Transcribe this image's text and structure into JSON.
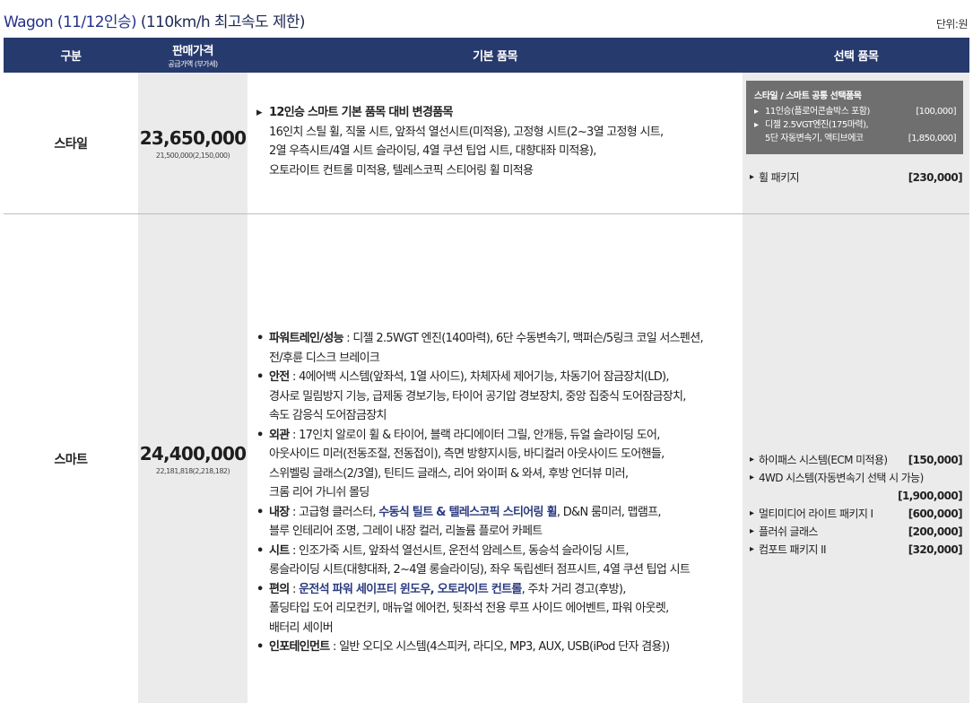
{
  "header": {
    "title_main": "Wagon (11/12인승)",
    "title_sub": "(110km/h 최고속도 제한)",
    "unit": "단위:원"
  },
  "columns": {
    "category": "구분",
    "price": "판매가격",
    "price_sub": "공급가액 (부가세)",
    "basic": "기본 품목",
    "options": "선택 품목"
  },
  "rows": [
    {
      "name": "스타일",
      "price": "23,650,000",
      "price_sub": "21,500,000(2,150,000)",
      "basic_head": "12인승 스마트 기본 품목 대비 변경품목",
      "basic_lines": [
        "16인치 스틸 휠, 직물 시트, 앞좌석 열선시트(미적용), 고정형 시트(2~3열 고정형 시트,",
        "2열 우측시트/4열 시트 슬라이딩, 4열 쿠션 팁업 시트, 대향대좌 미적용),",
        "오토라이트 컨트롤 미적용, 텔레스코픽 스티어링 휠 미적용"
      ],
      "option_box": {
        "title": "스타일 / 스마트 공통 선택품목",
        "items": [
          {
            "marker": "▸",
            "label": "11인승(플로어콘솔박스 포함)",
            "price": "[100,000]"
          },
          {
            "marker": "▸",
            "label": "디젤 2.5VGT엔진(175마력),",
            "price": ""
          },
          {
            "marker": "",
            "label": "5단 자동변속기, 액티브에코",
            "price": "[1,850,000]"
          }
        ]
      },
      "options": [
        {
          "label": "휠 패키지",
          "price": "[230,000]"
        }
      ]
    },
    {
      "name": "스마트",
      "price": "24,400,000",
      "price_sub": "22,181,818(2,218,182)",
      "basic_items": [
        {
          "head": "파워트레인/성능",
          "sep": " : ",
          "text": "디젤 2.5WGT 엔진(140마력), 6단 수동변속기, 맥퍼슨/5링크 코일 서스펜션,",
          "cont": [
            "전/후륜 디스크 브레이크"
          ]
        },
        {
          "head": "안전",
          "sep": " : ",
          "text": "4에어백 시스템(앞좌석, 1열 사이드), 차체자세 제어기능, 차동기어 잠금장치(LD),",
          "cont": [
            "경사로 밀림방지 기능, 급제동 경보기능, 타이어 공기압 경보장치, 중앙 집중식 도어잠금장치,",
            "속도 감응식 도어잠금장치"
          ]
        },
        {
          "head": "외관",
          "sep": " : ",
          "text": "17인치 알로이 휠 & 타이어, 블랙 라디에이터 그릴, 안개등, 듀얼 슬라이딩 도어,",
          "cont": [
            "아웃사이드 미러(전동조절, 전동접이), 측면 방향지시등, 바디컬러 아웃사이드 도어핸들,",
            "스위벨링 글래스(2/3열), 틴티드 글래스, 리어 와이퍼 & 와셔, 후방 언더뷰 미러,",
            "크롬 리어 가니쉬 몰딩"
          ]
        },
        {
          "head": "내장",
          "sep": " : ",
          "text_pre": "고급형 클러스터, ",
          "text_hl": "수동식 틸트 & 텔레스코픽 스티어링 휠",
          "text_post": ", D&N 룸미러, 맵램프,",
          "cont": [
            "블루 인테리어 조명, 그레이 내장 컬러, 리놀륨 플로어 카페트"
          ]
        },
        {
          "head": "시트",
          "sep": " : ",
          "text": "인조가죽 시트, 앞좌석 열선시트, 운전석 암레스트, 동승석 슬라이딩 시트,",
          "cont": [
            "롱슬라이딩 시트(대향대좌, 2~4열 롱슬라이딩), 좌우 독립센터 점프시트, 4열 쿠션 팁업 시트"
          ]
        },
        {
          "head": "편의",
          "sep": " : ",
          "text_pre": "",
          "text_hl": "운전석 파워 세이프티 윈도우, 오토라이트 컨트롤",
          "text_post": ", 주차 거리 경고(후방),",
          "cont": [
            "폴딩타입 도어 리모컨키, 매뉴얼 에어컨, 뒷좌석 전용 루프 사이드 에어벤트, 파워 아웃렛,",
            "배터리 세이버"
          ]
        },
        {
          "head": "인포테인먼트",
          "sep": " : ",
          "text": "일반 오디오 시스템(4스피커, 라디오, MP3, AUX, USB(iPod 단자 겸용))",
          "cont": []
        }
      ],
      "options": [
        {
          "label": "하이패스 시스템(ECM 미적용)",
          "price": "[150,000]"
        },
        {
          "label": "4WD 시스템(자동변속기 선택 시 가능)",
          "price": ""
        },
        {
          "label": "",
          "price": "[1,900,000]"
        },
        {
          "label": "멀티미디어 라이트 패키지 I",
          "price": "[600,000]"
        },
        {
          "label": "플러쉬 글래스",
          "price": "[200,000]"
        },
        {
          "label": "컴포트 패키지 II",
          "price": "[320,000]"
        }
      ]
    }
  ],
  "markers": {
    "triangle": "▸",
    "bullet": "•"
  }
}
